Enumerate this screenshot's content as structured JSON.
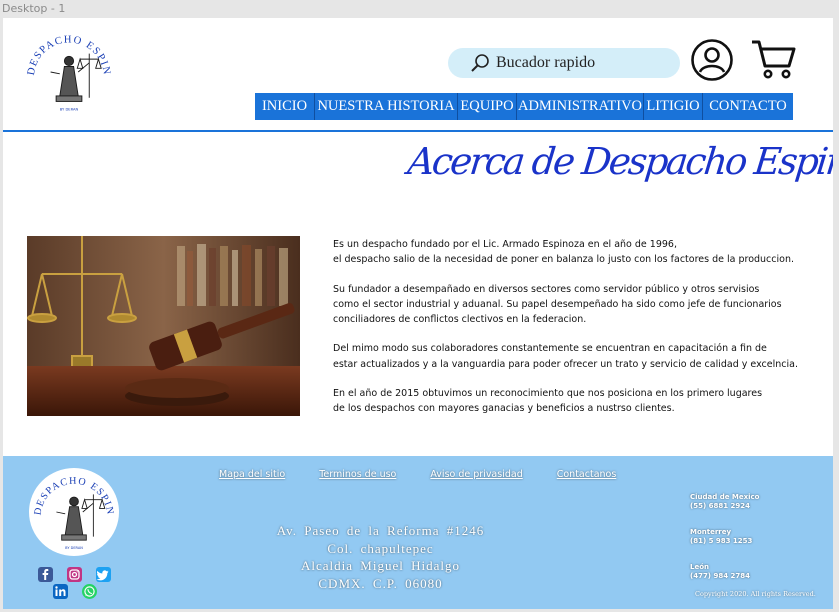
{
  "frame": {
    "label": "Desktop - 1"
  },
  "brand": {
    "name": "DESPACHO ESPINOZA",
    "tagline": "BY DERAN"
  },
  "header": {
    "search_placeholder": "Bucador rapido",
    "nav": [
      "INICIO",
      "NUESTRA  HISTORIA",
      "EQUIPO",
      "ADMINISTRATIVO",
      "LITIGIO",
      "CONTACTO"
    ]
  },
  "hero": {
    "title": "Acerca de Despacho Espinoza",
    "paragraphs": [
      "          Es un despacho fundado por  el  Lic. Armado Espinoza en el año de 1996,\n el despacho salio de la necesidad de poner en balanza lo justo con los factores de la produccion.",
      "          Su fundador a desempañado en diversos sectores como servidor público y otros servisios\ncomo  el sector industrial y aduanal. Su papel desempeñado ha sido como jefe de funcionarios\n conciliadores de conflictos clectivos en la federacion.",
      "Del mimo modo sus colaboradores constantemente se encuentran en capacitación a fin de\nestar actualizados y  a la vanguardia para poder ofrecer un trato y servicio de calidad y excelncia.",
      "En el año de 2015 obtuvimos un reconocimiento que nos posiciona en los primero lugares\nde los despachos con mayores ganacias y beneficios a nustrso clientes."
    ]
  },
  "footer": {
    "links": [
      "Mapa del sitio",
      "Terminos de uso",
      "Aviso de privasidad",
      "Contactanos"
    ],
    "address": [
      "Av.  Paseo  de  la  Reforma  #1246",
      "Col.  chapultepec",
      "Alcaldia  Miguel  Hidalgo",
      "CDMX.  C.P.  06080"
    ],
    "offices": [
      {
        "city": "Ciudad de Mexico",
        "phone": "(55) 6881 2924"
      },
      {
        "city": "Monterrey",
        "phone": "(81) 5 983 1253"
      },
      {
        "city": "León",
        "phone": "(477) 984 2784"
      }
    ],
    "copyright": "Copyright  2020.  All  rights  Reserved."
  },
  "social": [
    {
      "name": "facebook",
      "color": "#3b5998"
    },
    {
      "name": "instagram",
      "color": "#c13584"
    },
    {
      "name": "twitter",
      "color": "#1da1f2"
    },
    {
      "name": "linkedin",
      "color": "#0a66c2"
    },
    {
      "name": "whatsapp",
      "color": "#25d366"
    }
  ],
  "icons": [
    "search-icon",
    "user-icon",
    "cart-icon",
    "logo-justice",
    "facebook-icon",
    "instagram-icon",
    "twitter-icon",
    "linkedin-icon",
    "whatsapp-icon"
  ],
  "colors": {
    "nav": "#1a73d9",
    "footer": "#92c9f2",
    "search": "#d4eef9",
    "title": "#1a33c9"
  }
}
